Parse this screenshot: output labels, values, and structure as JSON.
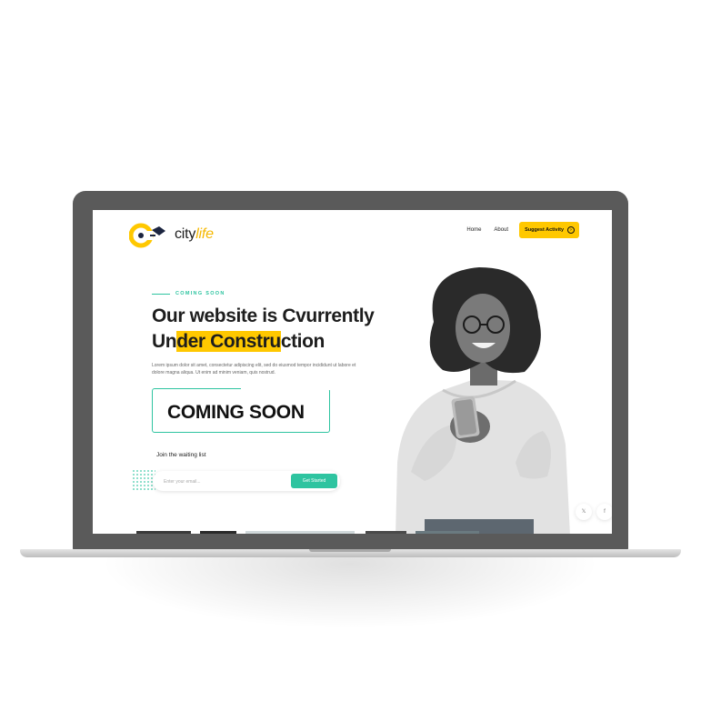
{
  "brand": {
    "name_prefix": "city",
    "name_suffix": "life"
  },
  "nav": {
    "items": [
      {
        "label": "Home"
      },
      {
        "label": "About"
      }
    ],
    "cta_label": "Suggest Activity",
    "cta_icon": "arrow-circle-right-icon"
  },
  "hero": {
    "eyebrow": "COMING SOON",
    "headline": {
      "line1": "Our website is Cvurrently",
      "line2_pre": "Un",
      "line2_highlight": "der Constru",
      "line2_post": "ction"
    },
    "paragraph": "Lorem ipsum dolor sit amet, consectetur adipiscing elit, sed do eiusmod tempor incididunt ut labore et dolore magna aliqua. Ut enim ad minim veniam, quis nostrud.",
    "countdown_text": "COMING SOON"
  },
  "waitlist": {
    "label": "Join the waiting list",
    "input_placeholder": "Enter your email...",
    "input_value": "",
    "button_label": "Get Started"
  },
  "social": {
    "twitter_glyph": "𝕏",
    "facebook_glyph": "f"
  },
  "colors": {
    "accent_yellow": "#ffc800",
    "accent_teal": "#2ec4a0",
    "text_dark": "#1d1d1d",
    "bezel": "#5a5a5a"
  },
  "icons": [
    "logo-key-icon",
    "arrow-circle-right-icon",
    "twitter-icon",
    "facebook-icon",
    "dot-grid-decoration"
  ]
}
